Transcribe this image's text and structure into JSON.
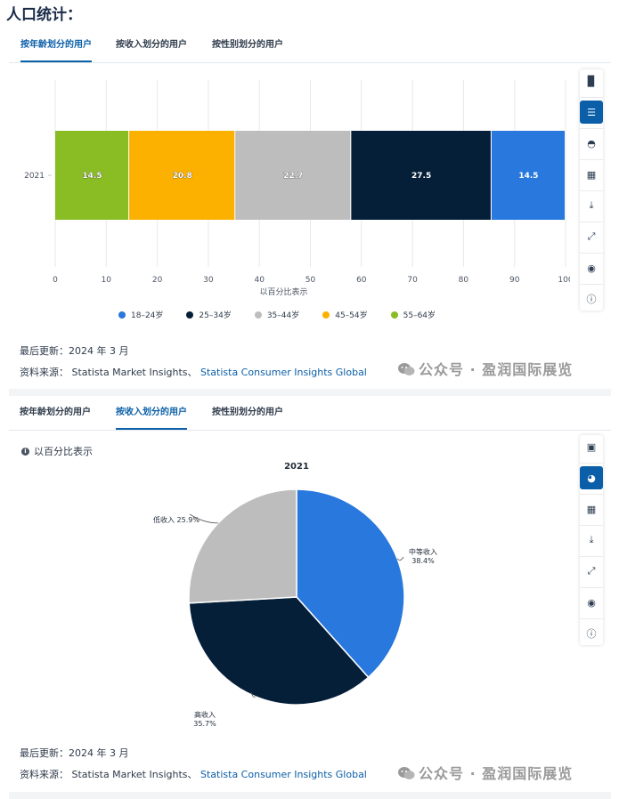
{
  "page_title": "人口统计：",
  "tabs": [
    "按年龄划分的用户",
    "按收入划分的用户",
    "按性别划分的用户"
  ],
  "chart1": {
    "x_axis_label": "以百分比表示"
  },
  "chart2": {
    "note": "以百分比表示"
  },
  "footer": {
    "last_updated": "最后更新：2024 年 3 月",
    "source_prefix": "资料来源：",
    "source_plain": "Statista Market Insights、",
    "source_link": "Statista Consumer Insights Global"
  },
  "watermark": "公众号 · 盈润国际展览",
  "colors": {
    "accent": "#0b5fa8",
    "green": "#8abd24",
    "orange": "#fcb100",
    "gray": "#bdbdbd",
    "navy": "#061f39",
    "blue": "#2878dd"
  },
  "toolbar1_icons": [
    "bar-chart-icon",
    "bar-chart-horizontal-icon",
    "gauge-icon",
    "table-icon",
    "download-icon",
    "expand-icon",
    "hide-icon",
    "info-icon"
  ],
  "toolbar2_icons": [
    "grid-icon",
    "pie-chart-icon",
    "table-icon",
    "download-icon",
    "expand-icon",
    "hide-icon",
    "info-icon"
  ],
  "chart_data": [
    {
      "type": "bar",
      "orientation": "horizontal-stacked",
      "categories": [
        "2021"
      ],
      "series": [
        {
          "name": "55–64岁",
          "values": [
            14.5
          ],
          "color": "#8abd24"
        },
        {
          "name": "45–54岁",
          "values": [
            20.8
          ],
          "color": "#fcb100"
        },
        {
          "name": "35–44岁",
          "values": [
            22.7
          ],
          "color": "#bdbdbd"
        },
        {
          "name": "25–34岁",
          "values": [
            27.5
          ],
          "color": "#061f39"
        },
        {
          "name": "18–24岁",
          "values": [
            14.5
          ],
          "color": "#2878dd"
        }
      ],
      "legend_order": [
        "18–24岁",
        "25–34岁",
        "35–44岁",
        "45–54岁",
        "55–64岁"
      ],
      "xlim": [
        0,
        100
      ],
      "xticks": [
        0,
        10,
        20,
        30,
        40,
        50,
        60,
        70,
        80,
        90,
        100
      ],
      "xlabel": "以百分比表示",
      "legend_position": "bottom",
      "grid": true
    },
    {
      "type": "pie",
      "title": "2021",
      "slices": [
        {
          "label": "中等收入",
          "value": 38.4,
          "display": "38.4%",
          "color": "#2878dd"
        },
        {
          "label": "高收入",
          "value": 35.7,
          "display": "35.7%",
          "color": "#061f39"
        },
        {
          "label": "低收入",
          "value": 25.9,
          "display": "25.9%",
          "color": "#bdbdbd"
        }
      ]
    }
  ]
}
